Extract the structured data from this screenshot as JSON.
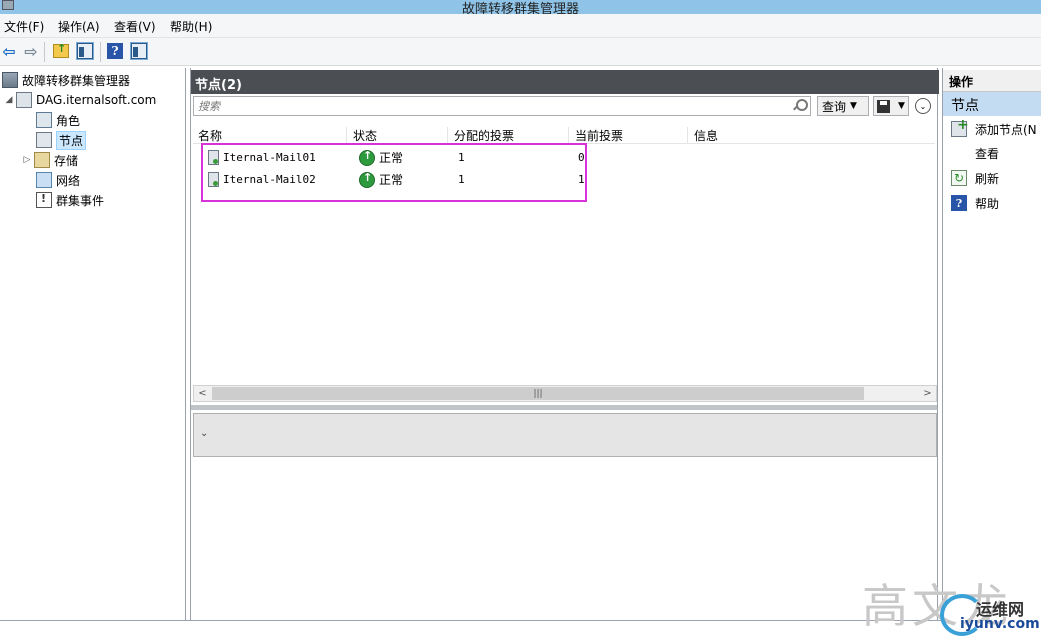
{
  "window": {
    "title": "故障转移群集管理器"
  },
  "menu": [
    "文件(F)",
    "操作(A)",
    "查看(V)",
    "帮助(H)"
  ],
  "tree": {
    "root": "故障转移群集管理器",
    "cluster": "DAG.iternalsoft.com",
    "items": [
      {
        "label": "角色",
        "icon": "roles-icon"
      },
      {
        "label": "节点",
        "icon": "nodes-icon"
      },
      {
        "label": "存储",
        "icon": "storage-icon"
      },
      {
        "label": "网络",
        "icon": "network-icon"
      },
      {
        "label": "群集事件",
        "icon": "events-icon"
      }
    ]
  },
  "center": {
    "header": "节点(2)",
    "search_placeholder": "搜索",
    "query_label": "查询",
    "columns": [
      "名称",
      "状态",
      "分配的投票",
      "当前投票",
      "信息"
    ],
    "rows": [
      {
        "name": "Iternal-Mail01",
        "status": "正常",
        "assigned_votes": "1",
        "current_votes": "0"
      },
      {
        "name": "Iternal-Mail02",
        "status": "正常",
        "assigned_votes": "1",
        "current_votes": "1"
      }
    ]
  },
  "actions": {
    "header": "操作",
    "section": "节点",
    "items": [
      {
        "label": "添加节点(N",
        "icon": "add-node-icon"
      },
      {
        "label": "查看",
        "icon": ""
      },
      {
        "label": "刷新",
        "icon": "refresh-icon"
      },
      {
        "label": "帮助",
        "icon": "help-icon"
      }
    ]
  },
  "watermark": {
    "text": "高文龙",
    "name": "运维网",
    "url": "iyunv.com"
  },
  "colors": {
    "highlight": "#d833d8",
    "header_bg": "#4b4f54",
    "actions_section_bg": "#c4dcf2"
  }
}
